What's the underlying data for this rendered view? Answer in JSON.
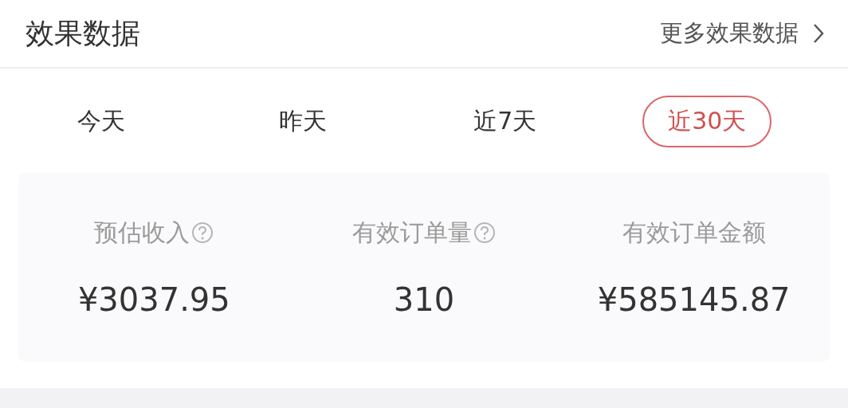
{
  "header": {
    "title": "效果数据",
    "more_link": "更多效果数据"
  },
  "tabs": [
    {
      "label": "今天",
      "selected": false
    },
    {
      "label": "昨天",
      "selected": false
    },
    {
      "label": "近7天",
      "selected": false
    },
    {
      "label": "近30天",
      "selected": true
    }
  ],
  "metrics": [
    {
      "label": "预估收入",
      "help": true,
      "value": "¥3037.95"
    },
    {
      "label": "有效订单量",
      "help": true,
      "value": "310"
    },
    {
      "label": "有效订单金额",
      "help": false,
      "value": "¥585145.87"
    }
  ]
}
